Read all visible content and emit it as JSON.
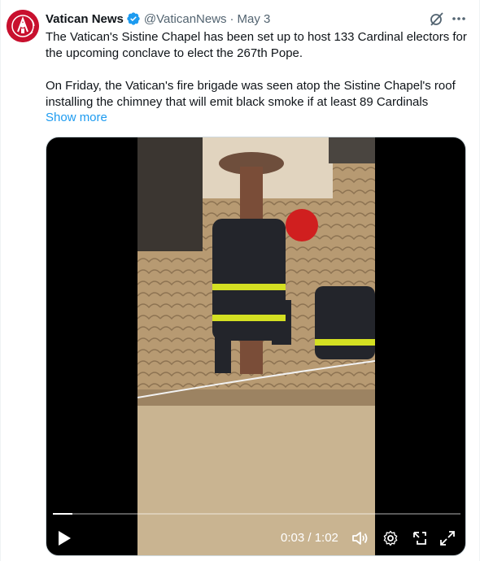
{
  "tweet": {
    "author_name": "Vatican News",
    "handle": "@VaticanNews",
    "separator": "·",
    "date": "May 3",
    "paragraph1": "The Vatican's Sistine Chapel has been set up to host 133 Cardinal electors for the upcoming conclave to elect the 267th Pope.",
    "paragraph2": "On Friday, the Vatican's fire brigade was seen atop the Sistine Chapel's roof installing the chimney that will emit black smoke if at least 89 Cardinals",
    "show_more": "Show more"
  },
  "video": {
    "time_display": "0:03 / 1:02",
    "progress": 0.048
  },
  "icons": {
    "verified": "verified-badge-icon",
    "grok": "grok-icon",
    "more": "more-options-icon",
    "play": "play-icon",
    "volume": "volume-icon",
    "settings": "settings-gear-icon",
    "pip": "picture-in-picture-icon",
    "fullscreen": "fullscreen-icon"
  },
  "colors": {
    "accent": "#1d9bf0",
    "avatar_red": "#c8102e",
    "text_primary": "#0f1419",
    "text_secondary": "#536471"
  }
}
